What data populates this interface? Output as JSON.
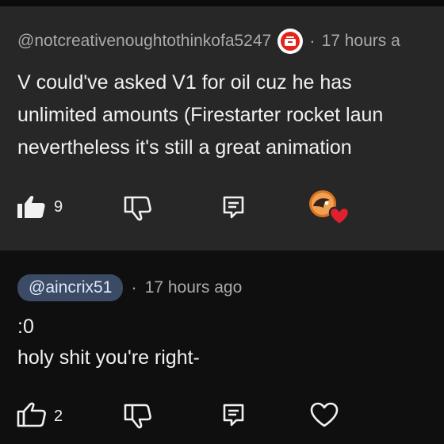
{
  "comment1": {
    "username": "@notcreativenoughtothinkofa5247",
    "separator": "·",
    "timestamp": "17 hours a",
    "lines": [
      "V could've asked V1 for oil cuz he has",
      "unlimited amounts (Firestarter rocket laun",
      "nevertheless it's still a great animation"
    ],
    "like_count": "9",
    "badge_icon": "membership-badge-icon",
    "creator_heart_icon": "creator-heart-icon",
    "accent_colors": {
      "badge": "#e1251b",
      "heart": "#e0202e",
      "avatar": "#e07a22"
    }
  },
  "comment2": {
    "mention": "@aincrix51",
    "separator": "·",
    "timestamp": "17 hours ago",
    "lines": [
      ":0",
      "holy shit you're right-"
    ],
    "like_count": "2"
  }
}
